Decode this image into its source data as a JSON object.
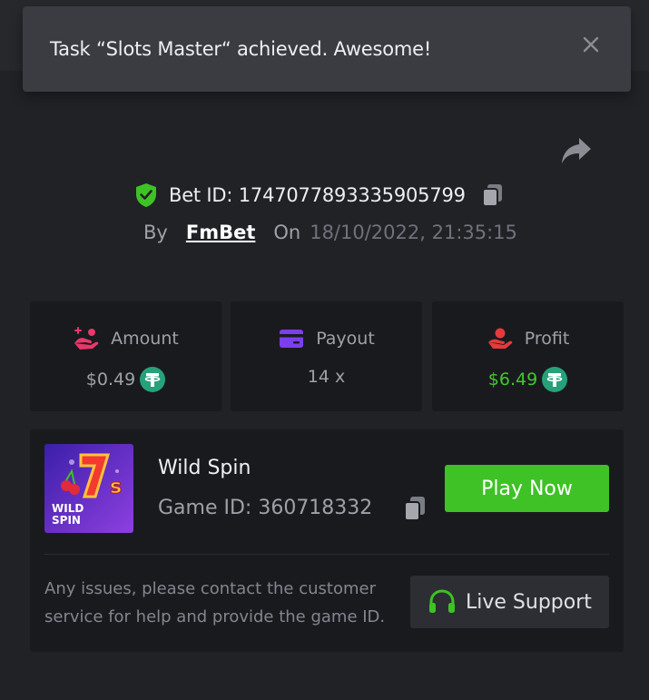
{
  "toast": {
    "message": "Task “Slots Master“ achieved. Awesome!",
    "close_icon": "close-icon"
  },
  "bet": {
    "id_text": "Bet ID: 1747077893335905799",
    "by_label": "By",
    "author": "FmBet",
    "on_label": "On",
    "date": "18/10/2022, 21:35:15"
  },
  "stats": [
    {
      "label": "Amount",
      "value": "$0.49",
      "icon": "hand-coins-icon",
      "currency_icon": "tether-icon"
    },
    {
      "label": "Payout",
      "value": "14 x",
      "icon": "wallet-card-icon"
    },
    {
      "label": "Profit",
      "value": "$6.49",
      "icon": "hand-profit-icon",
      "currency_icon": "tether-icon"
    }
  ],
  "game": {
    "name": "Wild Spin",
    "id_text": "Game ID: 360718332",
    "play_label": "Play Now",
    "thumb_title": "WILD",
    "thumb_subtitle": "SPIN"
  },
  "support": {
    "text": "Any issues, please contact the customer service for help and provide the game ID.",
    "button_label": "Live Support"
  },
  "colors": {
    "background": "#202226",
    "card": "#191a1e",
    "accent_green": "#3ec225",
    "amount_pink": "#e8386a",
    "payout_purple": "#7b3ff0",
    "profit_red": "#e53a3a",
    "tether_green": "#27a17a"
  }
}
